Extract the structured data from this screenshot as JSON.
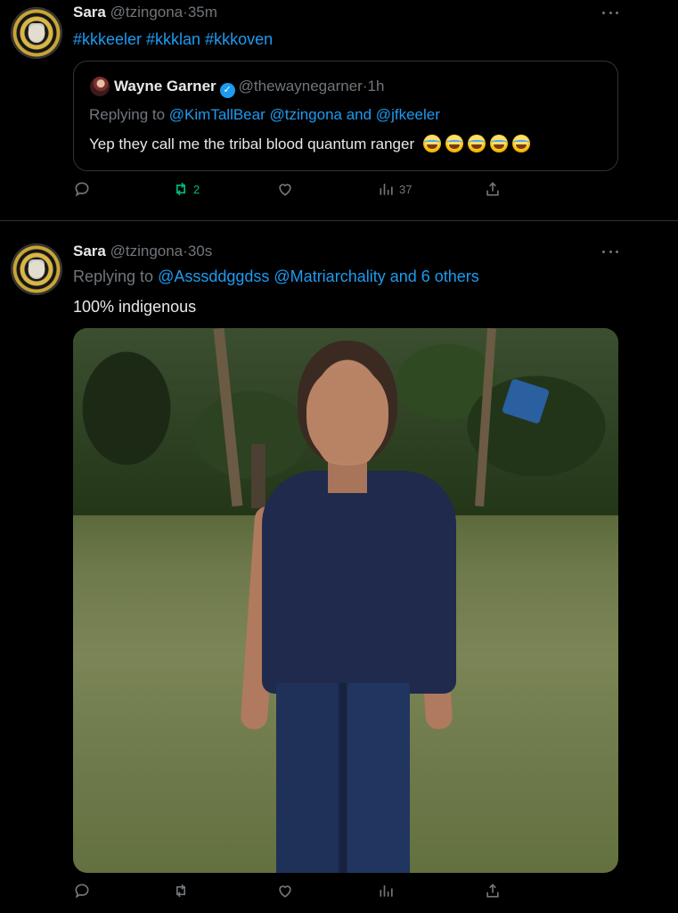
{
  "tweets": [
    {
      "author_name": "Sara",
      "author_handle": "@tzingona",
      "time": "35m",
      "text": "#kkkeeler #kkklan #kkkoven",
      "quoted": {
        "author_name": "Wayne Garner",
        "author_handle": "@thewaynegarner",
        "time": "1h",
        "replying_prefix": "Replying to",
        "replying_to": "@KimTallBear @tzingona and @jfkeeler",
        "text": "Yep they call me the tribal blood quantum ranger",
        "emoji_count": 5
      },
      "actions": {
        "reply_count": "",
        "retweet_count": "2",
        "like_count": "",
        "views_count": "37"
      }
    },
    {
      "author_name": "Sara",
      "author_handle": "@tzingona",
      "time": "30s",
      "replying_prefix": "Replying to",
      "replying_to": "@Asssddggdss @Matriarchality and 6 others",
      "text": "100% indigenous",
      "actions": {
        "reply_count": "",
        "retweet_count": "",
        "like_count": "",
        "views_count": ""
      }
    }
  ],
  "colors": {
    "background": "#000000",
    "text": "#e7e9ea",
    "muted": "#71767b",
    "link": "#1d9bf0",
    "retweet_active": "#00ba7c",
    "border": "#2f3336"
  }
}
